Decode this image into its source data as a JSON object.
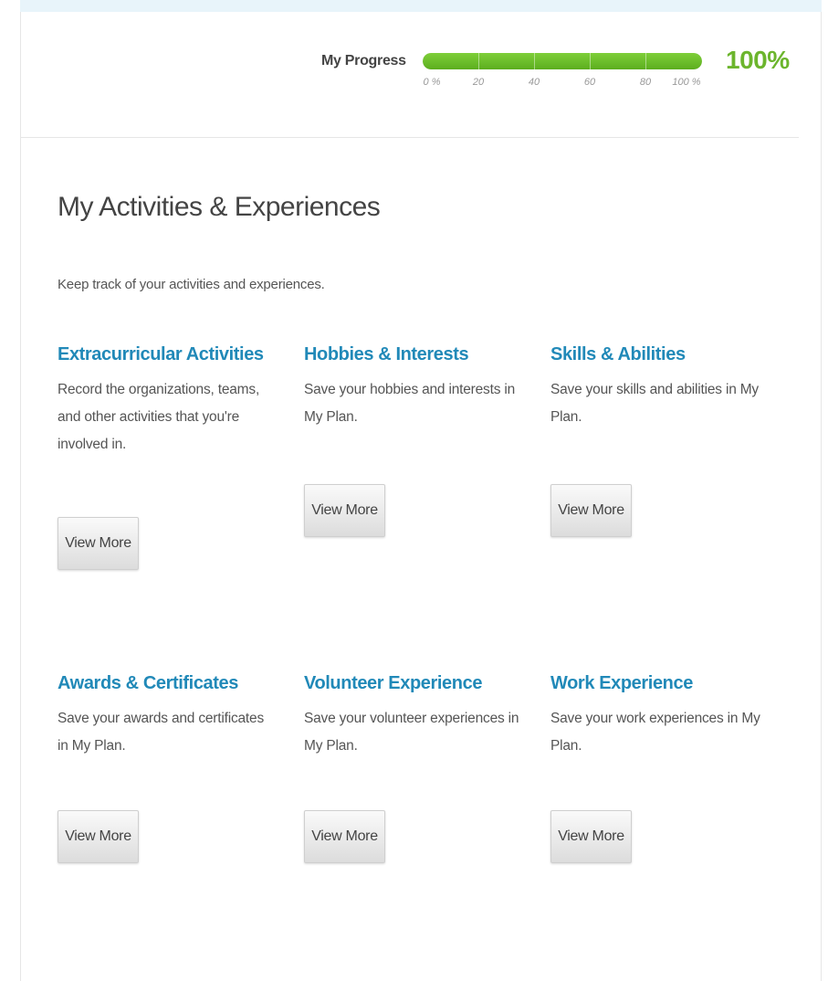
{
  "progress": {
    "label": "My Progress",
    "value_text": "100%",
    "fraction": 1.0,
    "ticks": [
      "0 %",
      "20",
      "40",
      "60",
      "80",
      "100 %"
    ],
    "fill_color": "#6cb52d"
  },
  "section": {
    "title": "My Activities & Experiences",
    "description": "Keep track of your activities and experiences."
  },
  "cards": [
    {
      "title": "Extracurricular Activities",
      "description": "Record the organizations, teams, and other activities that you're involved in.",
      "button": "View More"
    },
    {
      "title": "Hobbies & Interests",
      "description": "Save your hobbies and interests in My Plan.",
      "button": "View More"
    },
    {
      "title": "Skills & Abilities",
      "description": "Save your skills and abilities in My Plan.",
      "button": "View More"
    },
    {
      "title": "Awards & Certificates",
      "description": "Save your awards and certificates in My Plan.",
      "button": "View More"
    },
    {
      "title": "Volunteer Experience",
      "description": "Save your volunteer experiences in My Plan.",
      "button": "View More"
    },
    {
      "title": "Work Experience",
      "description": "Save your work experiences in My Plan.",
      "button": "View More"
    }
  ],
  "colors": {
    "title_blue": "#2189b8",
    "progress_green": "#6cb52d"
  }
}
